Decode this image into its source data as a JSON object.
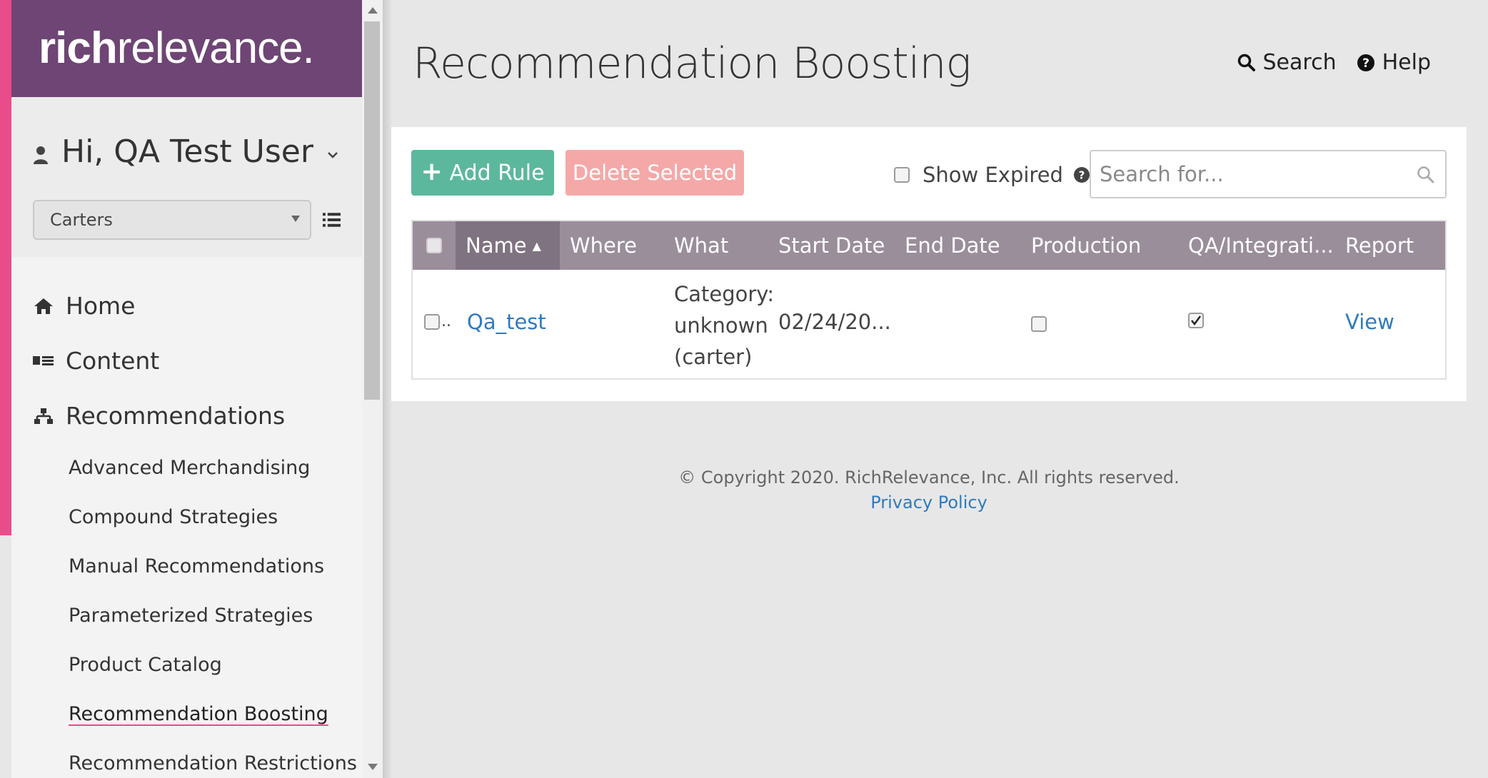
{
  "brand": {
    "logo_bold": "rich",
    "logo_light": "relevance."
  },
  "user": {
    "greeting": "Hi, QA Test User",
    "site_selected": "Carters"
  },
  "nav": {
    "items": [
      {
        "label": "Home",
        "icon": "home-icon"
      },
      {
        "label": "Content",
        "icon": "content-icon"
      },
      {
        "label": "Recommendations",
        "icon": "sitemap-icon"
      }
    ],
    "sub_items": [
      {
        "label": "Advanced Merchandising"
      },
      {
        "label": "Compound Strategies"
      },
      {
        "label": "Manual Recommendations"
      },
      {
        "label": "Parameterized Strategies"
      },
      {
        "label": "Product Catalog"
      },
      {
        "label": "Recommendation Boosting",
        "active": true
      },
      {
        "label": "Recommendation Restrictions"
      }
    ]
  },
  "page": {
    "title": "Recommendation Boosting",
    "search_link": "Search",
    "help_link": "Help"
  },
  "toolbar": {
    "add_rule": "Add Rule",
    "delete_selected": "Delete Selected",
    "show_expired": "Show Expired",
    "search_placeholder": "Search for..."
  },
  "table": {
    "columns": [
      "Name",
      "Where",
      "What",
      "Start Date",
      "End Date",
      "Production",
      "QA/Integrati...",
      "Report"
    ],
    "sort_indicator": "▲",
    "rows": [
      {
        "row_marker": "..",
        "name": "Qa_test",
        "where": "",
        "what_line1": "Category:",
        "what_line2": "unknown",
        "what_line3": "(carter)",
        "start_date": "02/24/20...",
        "end_date": "",
        "production": false,
        "qa_integration": true,
        "report": "View"
      }
    ]
  },
  "footer": {
    "copyright": "© Copyright 2020. RichRelevance, Inc. All rights reserved.",
    "privacy": "Privacy Policy"
  },
  "colors": {
    "brand_purple": "#6e4574",
    "accent_pink": "#e84d8a",
    "add_green": "#5cb89c",
    "delete_pink": "#f5a8a8",
    "table_header": "#9a8e9b",
    "link_blue": "#2e7bbf"
  }
}
